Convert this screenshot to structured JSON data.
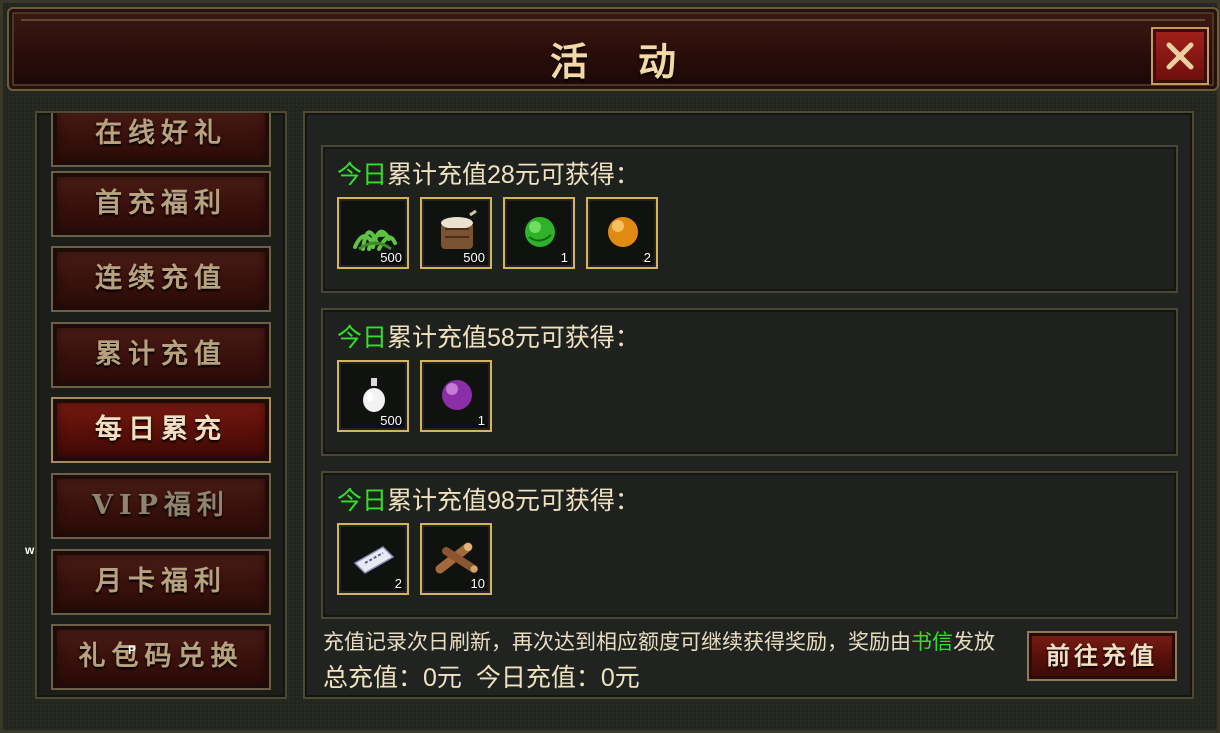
{
  "header": {
    "title": "活动"
  },
  "sidebar": {
    "items": [
      {
        "label": "在线好礼"
      },
      {
        "label": "首充福利"
      },
      {
        "label": "连续充值"
      },
      {
        "label": "累计充值"
      },
      {
        "label": "每日累充"
      },
      {
        "label": "VIP福利"
      },
      {
        "label": "月卡福利"
      },
      {
        "label": "礼包码兑换"
      }
    ],
    "active_index": 4
  },
  "tiers": [
    {
      "prefix": "今日",
      "text": "累计充值28元可获得：",
      "rewards": [
        {
          "icon": "herb-icon",
          "qty": "500"
        },
        {
          "icon": "drum-icon",
          "qty": "500"
        },
        {
          "icon": "green-orb-icon",
          "qty": "1"
        },
        {
          "icon": "orange-orb-icon",
          "qty": "2"
        }
      ]
    },
    {
      "prefix": "今日",
      "text": "累计充值58元可获得：",
      "rewards": [
        {
          "icon": "white-vase-icon",
          "qty": "500"
        },
        {
          "icon": "purple-orb-icon",
          "qty": "1"
        }
      ]
    },
    {
      "prefix": "今日",
      "text": "累计充值98元可获得：",
      "rewards": [
        {
          "icon": "ticket-icon",
          "qty": "2"
        },
        {
          "icon": "logs-icon",
          "qty": "10"
        }
      ]
    }
  ],
  "footer": {
    "note_before": "充值记录次日刷新，再次达到相应额度可继续获得奖励，奖励由",
    "note_highlight": "书信",
    "note_after": "发放",
    "total_label": "总充值：0元",
    "today_label": "今日充值：0元",
    "recharge_button": "前往充值"
  },
  "overlay_marks": {
    "w": "w",
    "p": "P"
  },
  "colors": {
    "highlight_green": "#31e02a",
    "gold_border": "#d4b55a",
    "title_gold": "#f3d9a6"
  }
}
